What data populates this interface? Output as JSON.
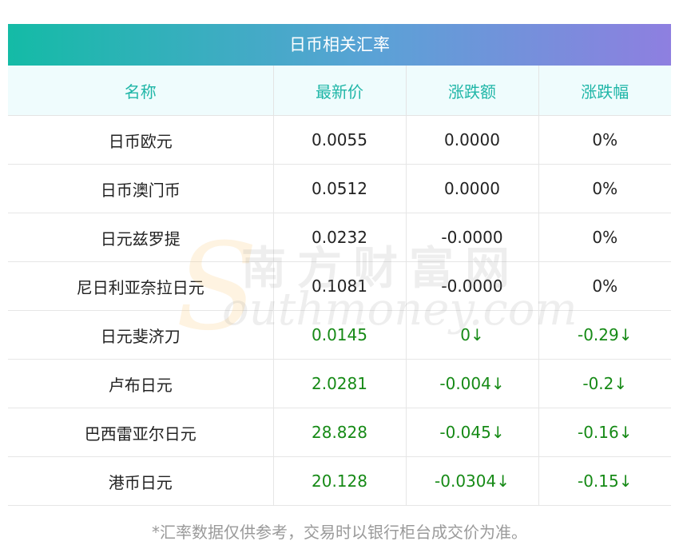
{
  "title": "日币相关汇率",
  "columns": [
    "名称",
    "最新价",
    "涨跌额",
    "涨跌幅"
  ],
  "rows": [
    {
      "name": "日币欧元",
      "price": "0.0055",
      "change": "0.0000",
      "pct": "0%",
      "down": false
    },
    {
      "name": "日币澳门币",
      "price": "0.0512",
      "change": "0.0000",
      "pct": "0%",
      "down": false
    },
    {
      "name": "日元兹罗提",
      "price": "0.0232",
      "change": "-0.0000",
      "pct": "0%",
      "down": false
    },
    {
      "name": "尼日利亚奈拉日元",
      "price": "0.1081",
      "change": "-0.0000",
      "pct": "0%",
      "down": false
    },
    {
      "name": "日元斐济刀",
      "price": "0.0145",
      "change": "0↓",
      "pct": "-0.29↓",
      "down": true
    },
    {
      "name": "卢布日元",
      "price": "2.0281",
      "change": "-0.004↓",
      "pct": "-0.2↓",
      "down": true
    },
    {
      "name": "巴西雷亚尔日元",
      "price": "28.828",
      "change": "-0.045↓",
      "pct": "-0.16↓",
      "down": true
    },
    {
      "name": "港币日元",
      "price": "20.128",
      "change": "-0.0304↓",
      "pct": "-0.15↓",
      "down": true
    }
  ],
  "footnote": "*汇率数据仅供参考，交易时以银行柜台成交价为准。",
  "watermark": {
    "s_letter": "S",
    "cn": "南方财富网",
    "en": "outhmoney.com"
  },
  "colors": {
    "header_text": "#1fb6a7",
    "down": "#168a16",
    "title_grad_start": "#14bba6",
    "title_grad_end": "#8e7fe0"
  }
}
